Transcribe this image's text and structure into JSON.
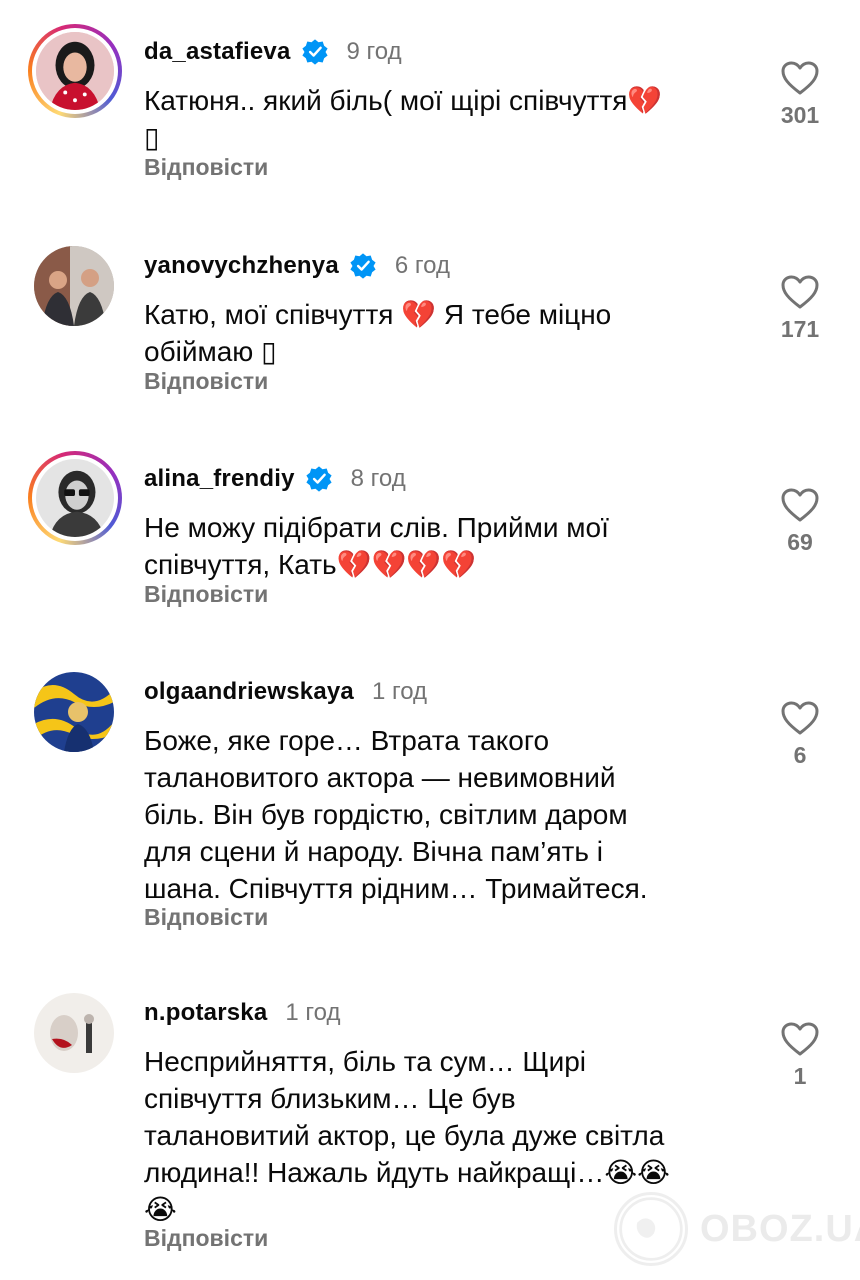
{
  "colors": {
    "muted": "#737373",
    "verified": "#0095f6",
    "text": "#0a0a0a"
  },
  "comments": [
    {
      "username": "da_astafieva",
      "verified": true,
      "time": "9 год",
      "text_line1": "Катюня.. який біль( мої щірі співчуття💔",
      "text_line2": "▯",
      "reply": "Відповісти",
      "likes": "301",
      "avatar": "woman-red-dress-avatar"
    },
    {
      "username": "yanovychzhenya",
      "verified": true,
      "time": "6 год",
      "text_line1": "Катю, мої співчуття 💔 Я тебе міцно",
      "text_line2": "обіймаю ▯",
      "reply": "Відповісти",
      "likes": "171",
      "avatar": "two-people-photo-avatar"
    },
    {
      "username": "alina_frendiy",
      "verified": true,
      "time": "8 год",
      "text_line1": "Не можу підібрати слів. Прийми мої",
      "text_line2": "співчуття, Кать💔💔💔💔",
      "reply": "Відповісти",
      "likes": "69",
      "avatar": "woman-sunglasses-bw-avatar"
    },
    {
      "username": "olgaandriewskaya",
      "verified": false,
      "time": "1 год",
      "text_line1": "Боже, яке горе… Втрата такого",
      "text_line2": "талановитого актора — невимовний",
      "text_line3": "біль. Він був гордістю, світлим даром",
      "text_line4": "для сцени й народу. Вічна пам’ять і",
      "text_line5": "шана. Співчуття рідним… Тримайтеся.",
      "reply": "Відповісти",
      "likes": "6",
      "avatar": "blue-yellow-art-avatar"
    },
    {
      "username": "n.potarska",
      "verified": false,
      "time": "1 год",
      "text_line1": "Несприйняття, біль та сум… Щирі",
      "text_line2": "співчуття близьким… Це був",
      "text_line3": "талановитий актор, це була дуже світла",
      "text_line4": "людина!! Нажаль йдуть найкращі…😭😭",
      "text_line5": "😭",
      "reply": "Відповісти",
      "likes": "1",
      "avatar": "illustration-avatar"
    }
  ],
  "watermark": {
    "text": "OBOZ.UA"
  }
}
